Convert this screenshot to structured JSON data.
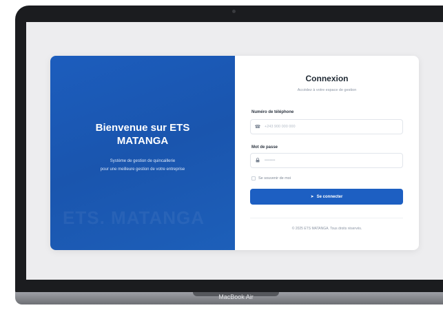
{
  "device": {
    "model_label": "MacBook Air"
  },
  "hero": {
    "title": "Bienvenue sur ETS MATANGA",
    "subtitle_line1": "Système de gestion de quincaillerie",
    "subtitle_line2": "pour une meilleure gestion de votre entreprise",
    "watermark": "ETS. MATANGA"
  },
  "login": {
    "title": "Connexion",
    "subtitle": "Accédez à votre espace de gestion",
    "phone_label": "Numéro de téléphone",
    "phone_placeholder": "+243 900 000 000",
    "phone_icon": "phone-icon",
    "password_label": "Mot de passe",
    "password_placeholder": "••••••••",
    "password_icon": "lock-icon",
    "remember_label": "Se souvenir de moi",
    "submit_label": "Se connecter",
    "submit_icon": "login-icon",
    "footer": "© 2025 ETS MATANGA. Tous droits réservés."
  },
  "colors": {
    "primary": "#1d5fc2",
    "hero_bg": "#1a55ae"
  }
}
